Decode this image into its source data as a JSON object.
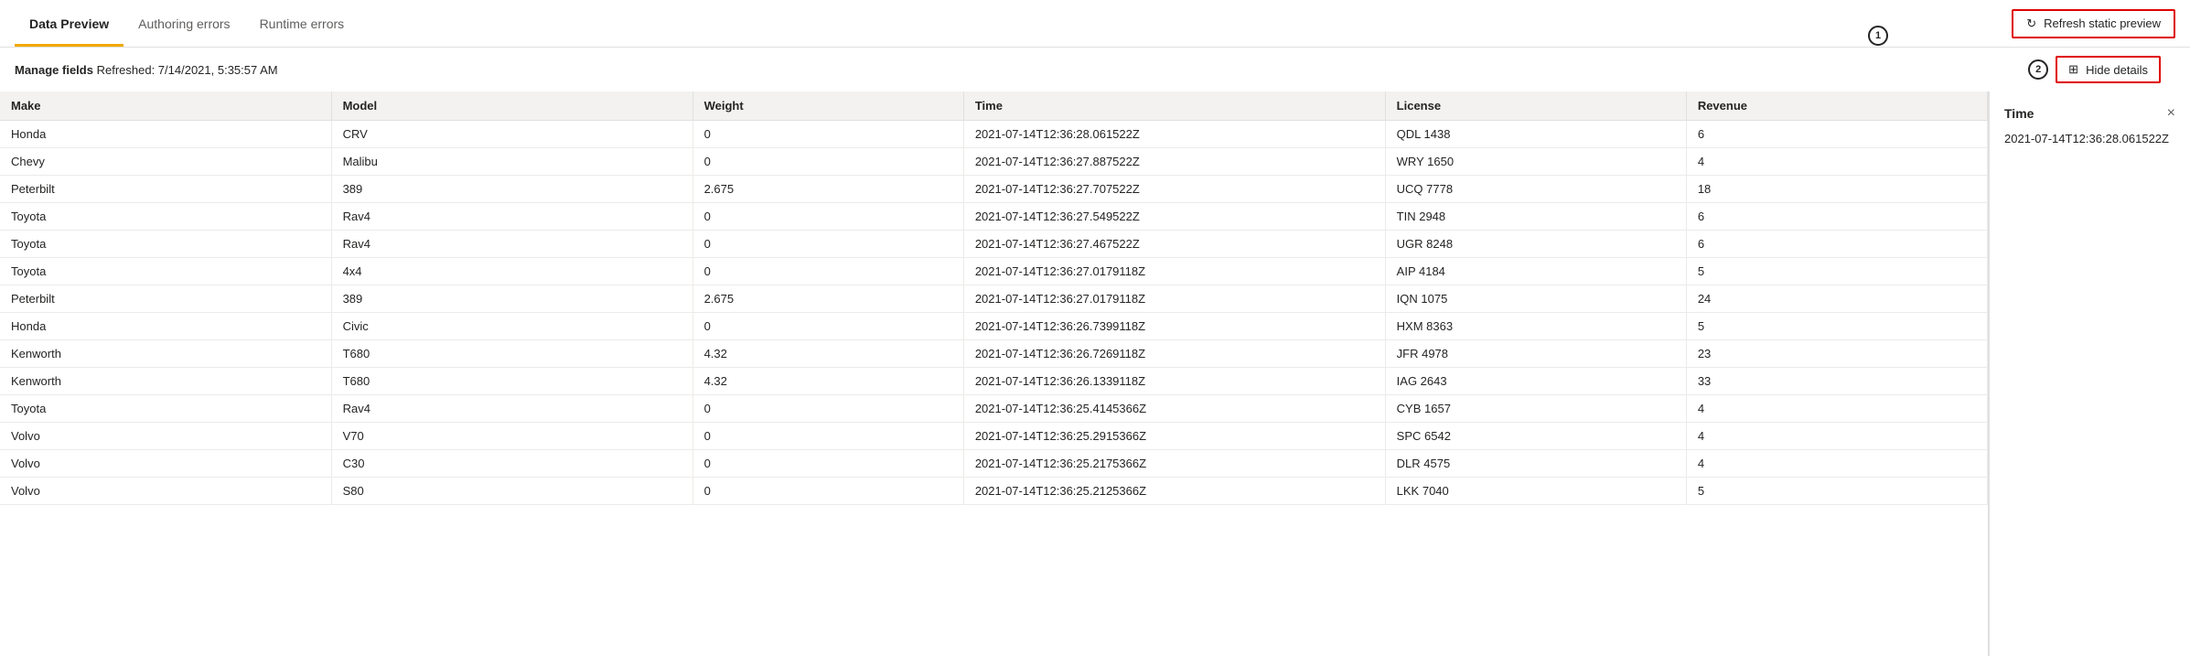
{
  "tabs": [
    {
      "id": "data-preview",
      "label": "Data Preview",
      "active": true
    },
    {
      "id": "authoring-errors",
      "label": "Authoring errors",
      "active": false
    },
    {
      "id": "runtime-errors",
      "label": "Runtime errors",
      "active": false
    }
  ],
  "toolbar": {
    "refresh_label": "Refresh static preview",
    "refresh_icon": "↻"
  },
  "subheader": {
    "manage_label": "Manage fields",
    "refreshed_label": "Refreshed: 7/14/2021, 5:35:57 AM",
    "hide_details_label": "Hide details",
    "hide_details_icon": "⊞"
  },
  "annotations": {
    "circle1": "1",
    "circle2": "2"
  },
  "table": {
    "columns": [
      {
        "id": "make",
        "label": "Make"
      },
      {
        "id": "model",
        "label": "Model"
      },
      {
        "id": "weight",
        "label": "Weight"
      },
      {
        "id": "time",
        "label": "Time"
      },
      {
        "id": "license",
        "label": "License"
      },
      {
        "id": "revenue",
        "label": "Revenue"
      }
    ],
    "rows": [
      {
        "make": "Honda",
        "model": "CRV",
        "weight": "0",
        "time": "2021-07-14T12:36:28.061522Z",
        "license": "QDL 1438",
        "revenue": "6"
      },
      {
        "make": "Chevy",
        "model": "Malibu",
        "weight": "0",
        "time": "2021-07-14T12:36:27.887522Z",
        "license": "WRY 1650",
        "revenue": "4"
      },
      {
        "make": "Peterbilt",
        "model": "389",
        "weight": "2.675",
        "time": "2021-07-14T12:36:27.707522Z",
        "license": "UCQ 7778",
        "revenue": "18"
      },
      {
        "make": "Toyota",
        "model": "Rav4",
        "weight": "0",
        "time": "2021-07-14T12:36:27.549522Z",
        "license": "TIN 2948",
        "revenue": "6"
      },
      {
        "make": "Toyota",
        "model": "Rav4",
        "weight": "0",
        "time": "2021-07-14T12:36:27.467522Z",
        "license": "UGR 8248",
        "revenue": "6"
      },
      {
        "make": "Toyota",
        "model": "4x4",
        "weight": "0",
        "time": "2021-07-14T12:36:27.0179118Z",
        "license": "AIP 4184",
        "revenue": "5"
      },
      {
        "make": "Peterbilt",
        "model": "389",
        "weight": "2.675",
        "time": "2021-07-14T12:36:27.0179118Z",
        "license": "IQN 1075",
        "revenue": "24"
      },
      {
        "make": "Honda",
        "model": "Civic",
        "weight": "0",
        "time": "2021-07-14T12:36:26.7399118Z",
        "license": "HXM 8363",
        "revenue": "5"
      },
      {
        "make": "Kenworth",
        "model": "T680",
        "weight": "4.32",
        "time": "2021-07-14T12:36:26.7269118Z",
        "license": "JFR 4978",
        "revenue": "23"
      },
      {
        "make": "Kenworth",
        "model": "T680",
        "weight": "4.32",
        "time": "2021-07-14T12:36:26.1339118Z",
        "license": "IAG 2643",
        "revenue": "33"
      },
      {
        "make": "Toyota",
        "model": "Rav4",
        "weight": "0",
        "time": "2021-07-14T12:36:25.4145366Z",
        "license": "CYB 1657",
        "revenue": "4"
      },
      {
        "make": "Volvo",
        "model": "V70",
        "weight": "0",
        "time": "2021-07-14T12:36:25.2915366Z",
        "license": "SPC 6542",
        "revenue": "4"
      },
      {
        "make": "Volvo",
        "model": "C30",
        "weight": "0",
        "time": "2021-07-14T12:36:25.2175366Z",
        "license": "DLR 4575",
        "revenue": "4"
      },
      {
        "make": "Volvo",
        "model": "S80",
        "weight": "0",
        "time": "2021-07-14T12:36:25.2125366Z",
        "license": "LKK 7040",
        "revenue": "5"
      }
    ]
  },
  "side_panel": {
    "title": "Time",
    "close_label": "×",
    "value": "2021-07-14T12:36:28.061522Z"
  }
}
